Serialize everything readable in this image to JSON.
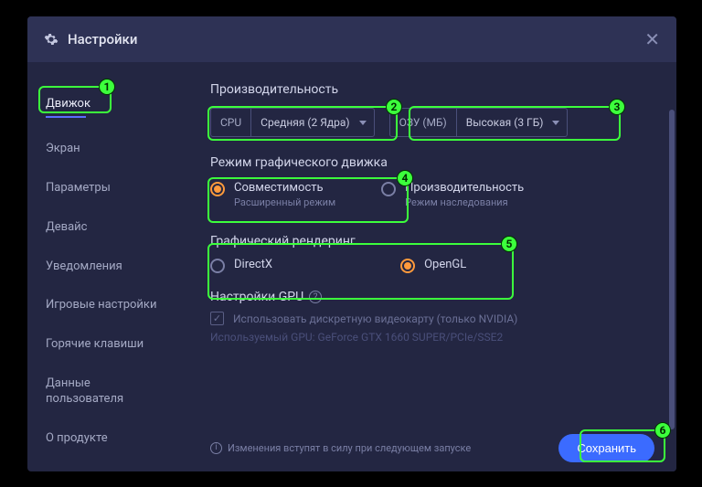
{
  "title": "Настройки",
  "sidebar": {
    "items": [
      "Движок",
      "Экран",
      "Параметры",
      "Девайс",
      "Уведомления",
      "Игровые настройки",
      "Горячие клавиши",
      "Данные пользователя",
      "О продукте"
    ]
  },
  "perf": {
    "title": "Производительность",
    "cpu_label": "CPU",
    "cpu_value": "Средняя (2 Ядра)",
    "ram_label": "ОЗУ (МБ)",
    "ram_value": "Высокая (3 ГБ)"
  },
  "engineMode": {
    "title": "Режим графического движка",
    "opt1_label": "Совместимость",
    "opt1_sub": "Расширенный режим",
    "opt2_label": "Производительность",
    "opt2_sub": "Режим наследования"
  },
  "render": {
    "title": "Графический рендеринг",
    "opt1": "DirectX",
    "opt2": "OpenGL"
  },
  "gpu": {
    "title": "Настройки GPU",
    "checkbox_label": "Использовать дискретную видеокарту (только NVIDIA)",
    "used": "Используемый GPU: GeForce GTX 1660 SUPER/PCIe/SSE2"
  },
  "footer": {
    "note": "Изменения вступят в силу при следующем запуске",
    "save": "Сохранить"
  },
  "annotations": [
    "1",
    "2",
    "3",
    "4",
    "5",
    "6"
  ]
}
